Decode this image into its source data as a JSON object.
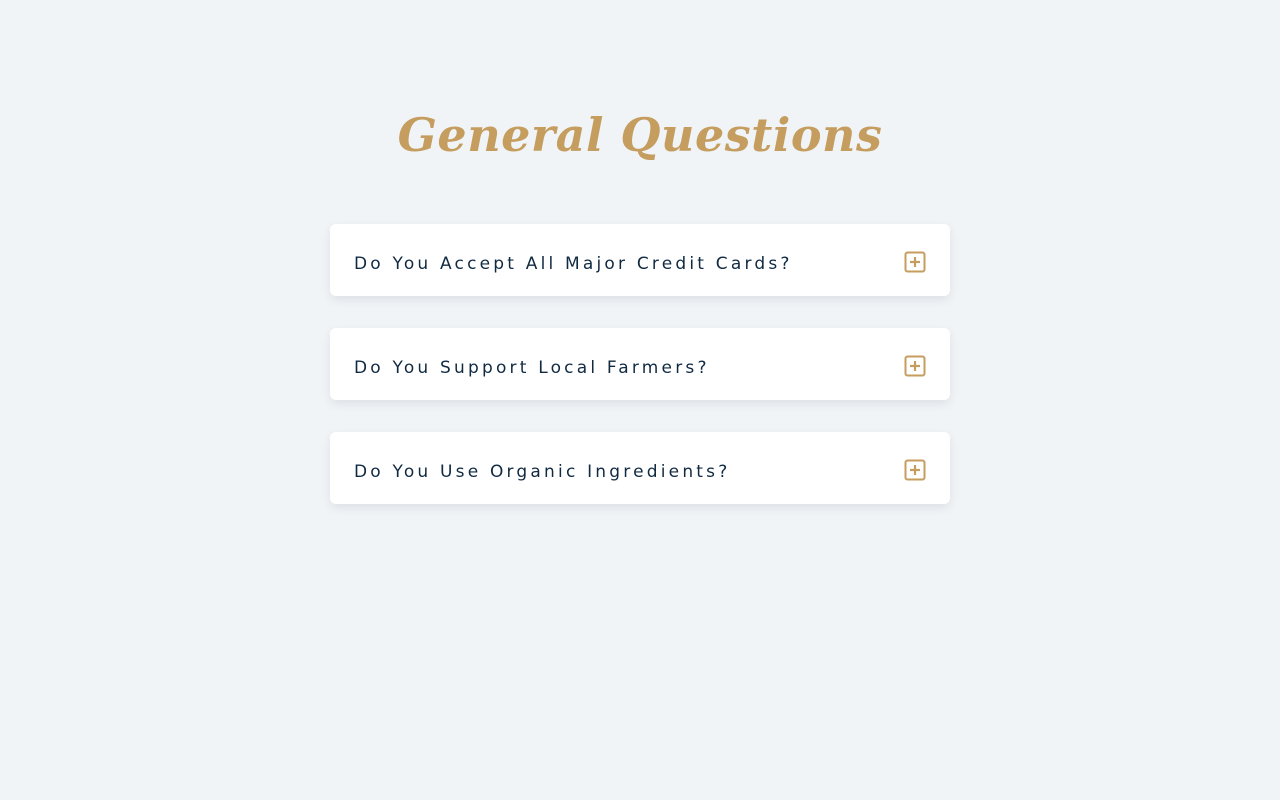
{
  "page": {
    "title": "General Questions"
  },
  "faq": {
    "items": [
      {
        "question": "Do You Accept All Major Credit Cards?",
        "icon": "plus-square-icon",
        "expanded": false
      },
      {
        "question": "Do You Support Local Farmers?",
        "icon": "plus-square-icon",
        "expanded": false
      },
      {
        "question": "Do You Use Organic Ingredients?",
        "icon": "plus-square-icon",
        "expanded": false
      }
    ]
  },
  "colors": {
    "background": "#f0f4f7",
    "accent": "#c59d5f",
    "text": "#102a42",
    "card": "#ffffff"
  }
}
